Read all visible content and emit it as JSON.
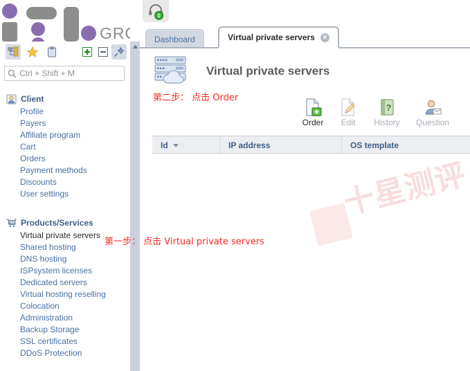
{
  "brand": {
    "name": "ITL",
    "suffix": "GROUP",
    "purple": "#8a6cb0",
    "gray": "#8d8d8d"
  },
  "topbar": {
    "support_icon": "headset-icon",
    "support_badge": "0",
    "badge_color": "#33aa33"
  },
  "sidebar": {
    "toolbar": [
      {
        "icon": "tree-list-icon",
        "name": "tree-view-button",
        "boxed": true
      },
      {
        "icon": "star-icon",
        "name": "favorites-button",
        "boxed": false
      },
      {
        "icon": "clipboard-icon",
        "name": "clipboard-button",
        "boxed": false
      },
      {
        "icon": "expand-plus-icon",
        "name": "expand-all-button",
        "boxed": false
      },
      {
        "icon": "collapse-minus-icon",
        "name": "collapse-all-button",
        "boxed": false
      },
      {
        "icon": "pin-icon",
        "name": "pin-sidebar-button",
        "boxed": true
      }
    ],
    "search": {
      "placeholder": "Ctrl + Shift + M",
      "value": "",
      "icon": "search-icon"
    },
    "sections": [
      {
        "title": "Client",
        "icon": "user-icon",
        "items": [
          {
            "label": "Profile",
            "selected": false
          },
          {
            "label": "Payers",
            "selected": false
          },
          {
            "label": "Affiliate program",
            "selected": false
          },
          {
            "label": "Cart",
            "selected": false
          },
          {
            "label": "Orders",
            "selected": false
          },
          {
            "label": "Payment methods",
            "selected": false
          },
          {
            "label": "Discounts",
            "selected": false
          },
          {
            "label": "User settings",
            "selected": false
          }
        ]
      },
      {
        "title": "Products/Services",
        "icon": "shopping-cart-icon",
        "items": [
          {
            "label": "Virtual private servers",
            "selected": true
          },
          {
            "label": "Shared hosting",
            "selected": false
          },
          {
            "label": "DNS hosting",
            "selected": false
          },
          {
            "label": "ISPsystem licenses",
            "selected": false
          },
          {
            "label": "Dedicated servers",
            "selected": false
          },
          {
            "label": "Virtual hosting reselling",
            "selected": false
          },
          {
            "label": "Colocation",
            "selected": false
          },
          {
            "label": "Administration",
            "selected": false
          },
          {
            "label": "Backup Storage",
            "selected": false
          },
          {
            "label": "SSL certificates",
            "selected": false
          },
          {
            "label": "DDoS Protection",
            "selected": false
          }
        ]
      }
    ]
  },
  "tabs": [
    {
      "label": "Dashboard",
      "active": false,
      "closable": false
    },
    {
      "label": "Virtual private servers",
      "active": true,
      "closable": true,
      "close_glyph": "×"
    }
  ],
  "page": {
    "title": "Virtual private servers",
    "icon": "server-cloud-icon"
  },
  "actions": [
    {
      "label": "Order",
      "icon": "page-add-icon",
      "enabled": true
    },
    {
      "label": "Edit",
      "icon": "page-edit-icon",
      "enabled": false
    },
    {
      "label": "History",
      "icon": "book-question-icon",
      "enabled": false
    },
    {
      "label": "Question",
      "icon": "user-message-icon",
      "enabled": false
    }
  ],
  "table": {
    "columns": [
      {
        "label": "Id",
        "sorted": true,
        "sort_dir": "desc",
        "width": 98
      },
      {
        "label": "IP address",
        "sorted": false,
        "width": 176
      },
      {
        "label": "OS template",
        "sorted": false,
        "width": 185
      }
    ],
    "rows": []
  },
  "watermark": {
    "text": "十星测评"
  },
  "annotations": [
    {
      "id": "step1",
      "text": "第一步： 点击 Virtual private servers",
      "color": "#fb2a23"
    },
    {
      "id": "step2",
      "text": "第二步： 点击 Order",
      "color": "#fb2a23"
    }
  ]
}
